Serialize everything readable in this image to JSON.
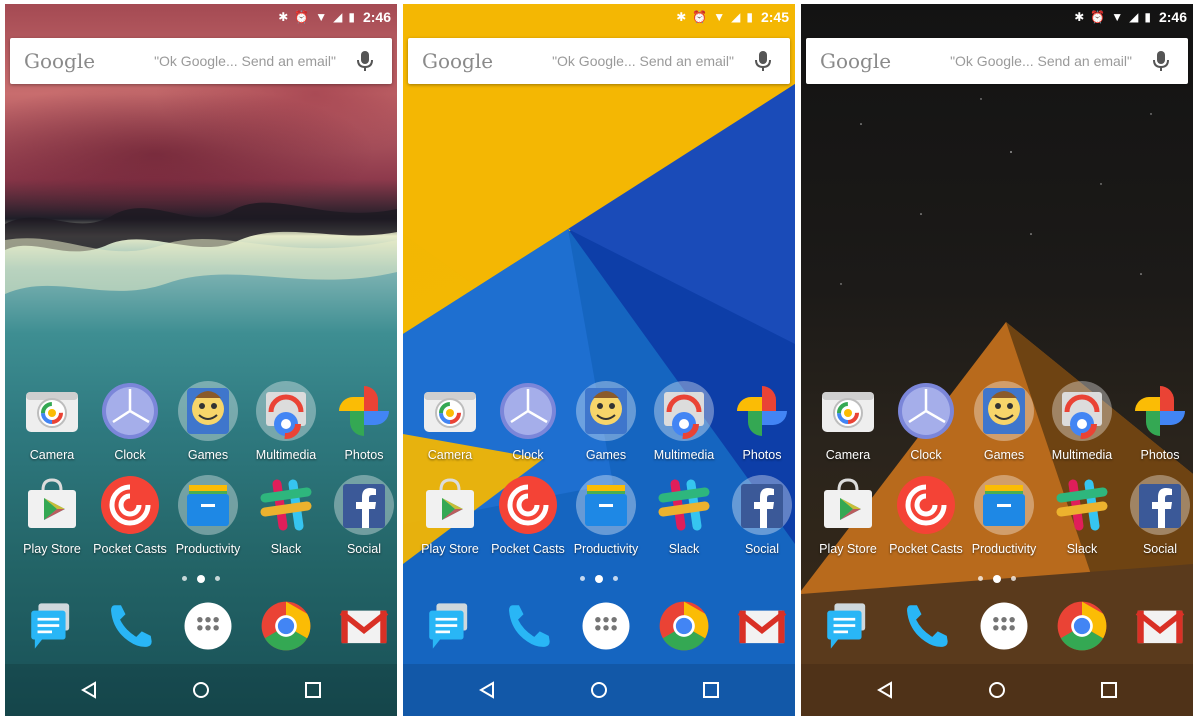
{
  "screens": [
    {
      "id": "p1",
      "time": "2:46"
    },
    {
      "id": "p2",
      "time": "2:45"
    },
    {
      "id": "p3",
      "time": "2:46"
    }
  ],
  "search": {
    "logo": "Google",
    "hint": "\"Ok Google... Send an email\""
  },
  "apps": [
    {
      "label": "Camera",
      "icon": "camera-icon"
    },
    {
      "label": "Clock",
      "icon": "clock-icon"
    },
    {
      "label": "Games",
      "icon": "games-folder-icon"
    },
    {
      "label": "Multimedia",
      "icon": "multimedia-folder-icon"
    },
    {
      "label": "Photos",
      "icon": "photos-icon"
    },
    {
      "label": "Play Store",
      "icon": "play-store-icon"
    },
    {
      "label": "Pocket Casts",
      "icon": "pocket-casts-icon"
    },
    {
      "label": "Productivity",
      "icon": "productivity-folder-icon"
    },
    {
      "label": "Slack",
      "icon": "slack-icon"
    },
    {
      "label": "Social",
      "icon": "social-folder-icon"
    }
  ],
  "dock": [
    {
      "icon": "messenger-icon"
    },
    {
      "icon": "phone-icon"
    },
    {
      "icon": "app-drawer-icon"
    },
    {
      "icon": "chrome-icon"
    },
    {
      "icon": "gmail-icon"
    }
  ],
  "page_indicator": {
    "count": 3,
    "active": 2
  },
  "navbar": [
    {
      "icon": "back-icon"
    },
    {
      "icon": "home-icon"
    },
    {
      "icon": "recents-icon"
    }
  ],
  "colors": {
    "accent_yellow": "#f2b503",
    "accent_blue": "#1b4fc0",
    "search_text": "#9a9a9a"
  }
}
